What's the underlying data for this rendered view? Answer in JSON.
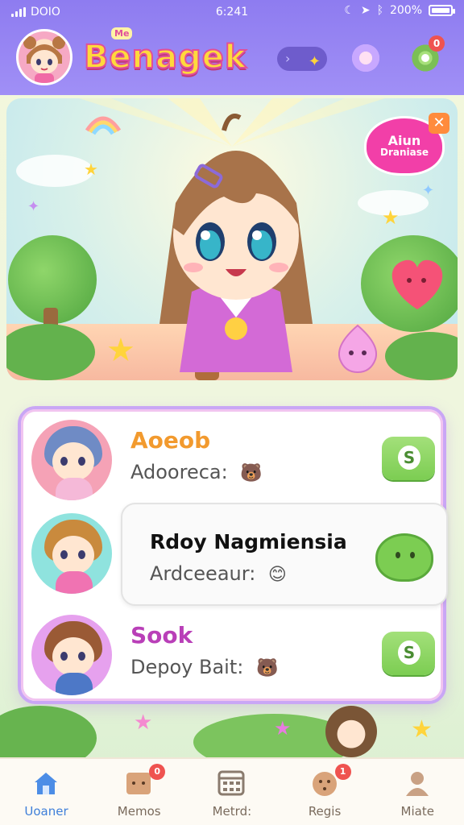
{
  "status_bar": {
    "carrier": "DOIO",
    "time": "6:241",
    "battery": "200%"
  },
  "header": {
    "app_title": "Benagek",
    "title_tag": "Me",
    "pill_glyph": "›",
    "notification_count": "0",
    "accent": "#8e7cf0"
  },
  "hero": {
    "bubble_line1": "Aiun",
    "bubble_line2": "Draniase"
  },
  "friends": [
    {
      "name": "Aoeob",
      "status": "Adooreca:",
      "name_color": "#f29a2e",
      "mood_icon": "🐻",
      "chat_glyph": "S"
    },
    {
      "name": "Rdoy Nagmiensia",
      "status": "Ardceeaur:",
      "name_color": "#111111",
      "mood_icon": "😊",
      "chat_glyph": ""
    },
    {
      "name": "Sook",
      "status": "Depoy Bait:",
      "name_color": "#b93fb8",
      "mood_icon": "🐻",
      "chat_glyph": "S"
    }
  ],
  "nav": {
    "items": [
      {
        "label": "Uoaner",
        "icon": "home-icon",
        "active": true
      },
      {
        "label": "Memos",
        "icon": "memo-box-icon",
        "badge": "0"
      },
      {
        "label": "Metrd:",
        "icon": "grid-calendar-icon"
      },
      {
        "label": "Regis",
        "icon": "cookie-icon",
        "badge": "1"
      },
      {
        "label": "Miate",
        "icon": "person-icon"
      }
    ]
  }
}
